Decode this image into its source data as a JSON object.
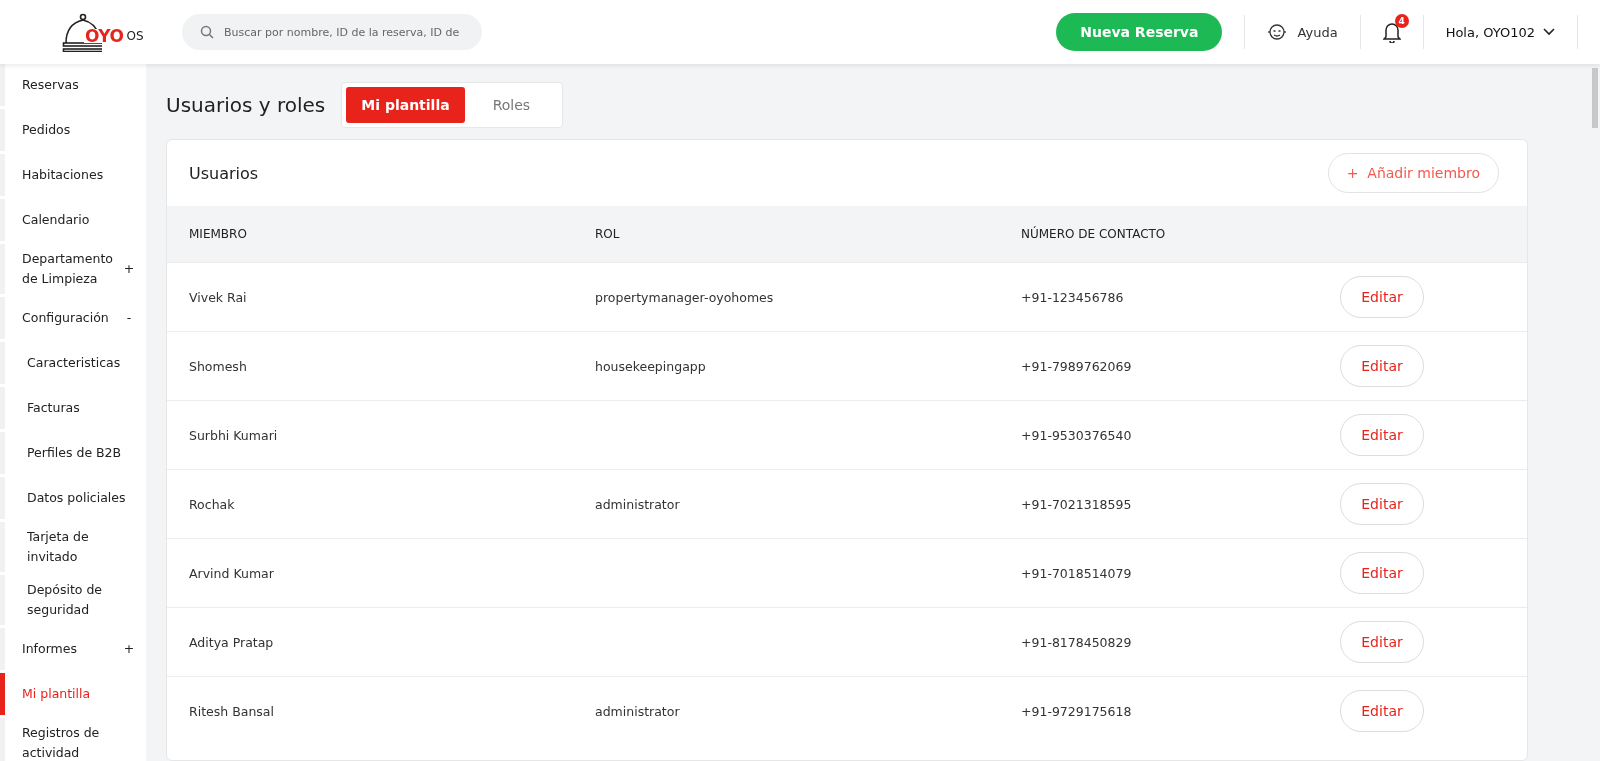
{
  "header": {
    "logo": {
      "mark": "OYO",
      "suffix": "OS"
    },
    "search": {
      "placeholder": "Buscar por nombre, ID de la reserva, ID de"
    },
    "new_booking": "Nueva Reserva",
    "help": "Ayuda",
    "notifications": {
      "count": "4"
    },
    "user": "Hola, OYO102"
  },
  "sidebar": {
    "items": [
      {
        "label": "Reservas",
        "selected": false
      },
      {
        "label": "Pedidos",
        "selected": false
      },
      {
        "label": "Habitaciones",
        "selected": false
      },
      {
        "label": "Calendario",
        "selected": false
      },
      {
        "label": "Departamento de Limpieza",
        "toggle": "+",
        "selected": false
      },
      {
        "label": "Configuración",
        "toggle": "-",
        "selected": false,
        "children": [
          {
            "label": "Caracteristicas",
            "selected": false
          },
          {
            "label": "Facturas",
            "selected": false
          },
          {
            "label": "Perfiles de B2B",
            "selected": false
          },
          {
            "label": "Datos policiales",
            "selected": false
          },
          {
            "label": "Tarjeta de invitado",
            "selected": false
          },
          {
            "label": "Depósito de seguridad",
            "selected": false
          }
        ]
      },
      {
        "label": "Informes",
        "toggle": "+",
        "selected": false
      },
      {
        "label": "Mi plantilla",
        "selected": true
      },
      {
        "label": "Registros de actividad",
        "selected": false
      }
    ]
  },
  "page": {
    "title": "Usuarios y roles",
    "tabs": [
      {
        "label": "Mi plantilla",
        "selected": true
      },
      {
        "label": "Roles",
        "selected": false
      }
    ]
  },
  "users": {
    "title": "Usuarios",
    "add_button": "+  Añadir miembro",
    "columns": [
      "MIEMBRO",
      "ROL",
      "NÚMERO DE CONTACTO"
    ],
    "rows": [
      {
        "member": "Vivek Rai",
        "role": "propertymanager-oyohomes",
        "phone": "+91-123456786",
        "action": "Editar"
      },
      {
        "member": "Shomesh",
        "role": "housekeepingapp",
        "phone": "+91-7989762069",
        "action": "Editar"
      },
      {
        "member": "Surbhi Kumari",
        "phone": "+91-9530376540",
        "action": "Editar"
      },
      {
        "member": "Rochak",
        "role": "administrator",
        "phone": "+91-7021318595",
        "action": "Editar"
      },
      {
        "member": "Arvind Kumar",
        "phone": "+91-7018514079",
        "action": "Editar"
      },
      {
        "member": "Aditya Pratap",
        "phone": "+91-8178450829",
        "action": "Editar"
      },
      {
        "member": "Ritesh Bansal",
        "role": "administrator",
        "phone": "+91-9729175618",
        "action": "Editar"
      }
    ]
  }
}
